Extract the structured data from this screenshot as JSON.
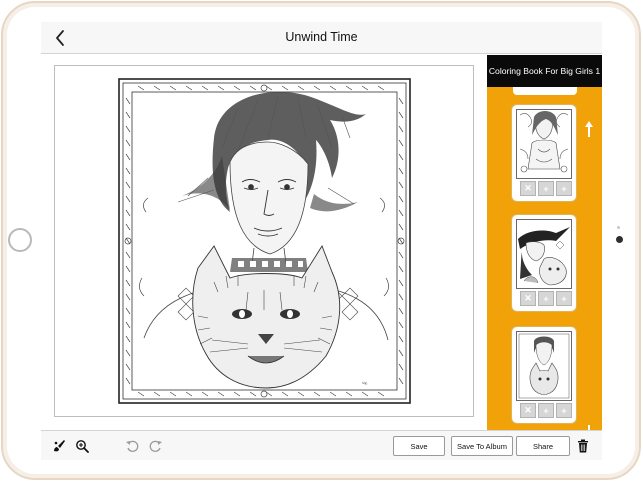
{
  "nav": {
    "title": "Unwind Time",
    "back_icon": "chevron-left-icon"
  },
  "side_panel": {
    "book_title": "Coloring Book For Big Girls 1",
    "accent_color": "#f1a208",
    "thumbnails": [
      {
        "name": "thumbnail-woman-leaves"
      },
      {
        "name": "thumbnail-woman-witch"
      },
      {
        "name": "thumbnail-woman-lynx"
      }
    ],
    "scroll_up_icon": "arrow-up-icon",
    "scroll_down_icon": "arrow-down-icon"
  },
  "toolbar": {
    "tools": [
      "brush-icon",
      "zoom-in-icon",
      "undo-icon",
      "redo-icon"
    ],
    "save_label": "Save",
    "save_to_album_label": "Save To Album",
    "share_label": "Share",
    "delete_icon": "trash-icon"
  }
}
